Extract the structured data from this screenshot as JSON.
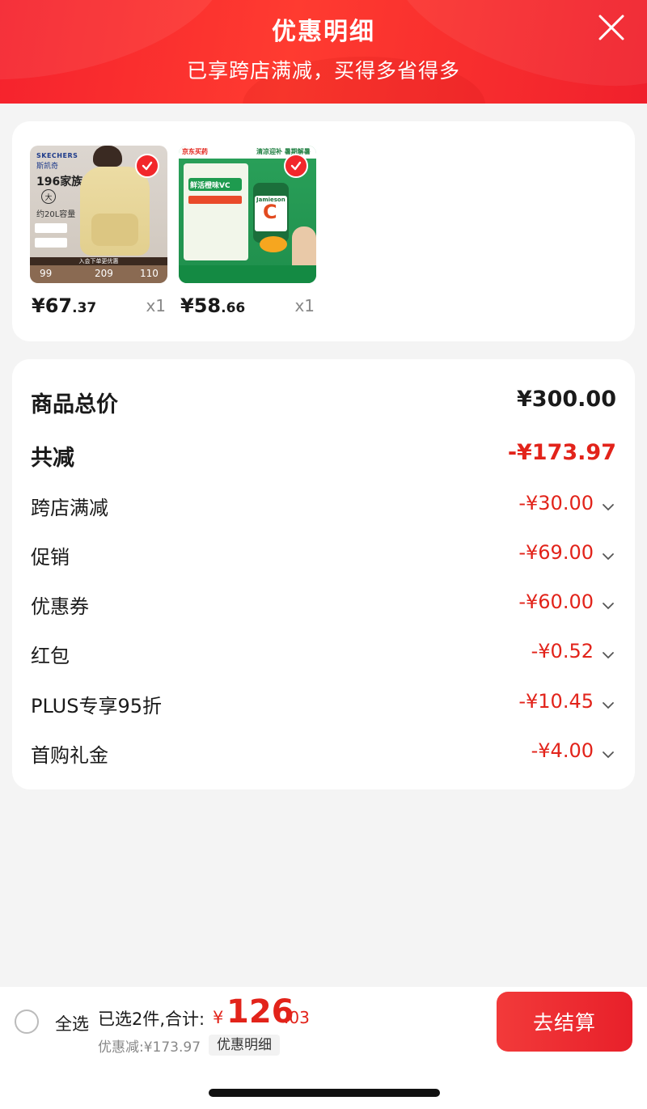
{
  "header": {
    "title": "优惠明细",
    "subtitle": "已享跨店满减，买得多省得多"
  },
  "products": [
    {
      "price_int": "¥67",
      "price_dec": ".37",
      "qty": "x1",
      "thumb_text": {
        "brand": "SKECHERS",
        "brand_cn": "斯凯奇",
        "family": "196家族",
        "size_badge": "大",
        "volume": "约20L容量",
        "strip": "入会下单更优惠",
        "n1": "99",
        "n2": "209",
        "n3": "110"
      }
    },
    {
      "price_int": "¥58",
      "price_dec": ".66",
      "qty": "x1",
      "thumb_text": {
        "top_left": "京东买药",
        "top_right": "清凉迎补 暑期解暑",
        "line1": "鲜活橙味VC",
        "brand": "Jamieson",
        "letter": "C"
      }
    }
  ],
  "summary": {
    "total_label": "商品总价",
    "total_value": "¥300.00",
    "reduced_label": "共减",
    "reduced_value": "-¥173.97",
    "items": [
      {
        "label": "跨店满减",
        "value": "-¥30.00"
      },
      {
        "label": "促销",
        "value": "-¥69.00"
      },
      {
        "label": "优惠券",
        "value": "-¥60.00"
      },
      {
        "label": "红包",
        "value": "-¥0.52"
      },
      {
        "label": "PLUS专享95折",
        "value": "-¥10.45"
      },
      {
        "label": "首购礼金",
        "value": "-¥4.00"
      }
    ]
  },
  "bottom_bar": {
    "select_all": "全选",
    "selected_text": "已选2件,合计:",
    "currency": "¥",
    "total_int": "126",
    "total_dec": ".03",
    "discount_text": "优惠减:¥173.97",
    "detail_button": "优惠明细",
    "checkout_button": "去结算"
  },
  "colors": {
    "accent_red": "#e2231a",
    "header_red": "#f5222d"
  }
}
